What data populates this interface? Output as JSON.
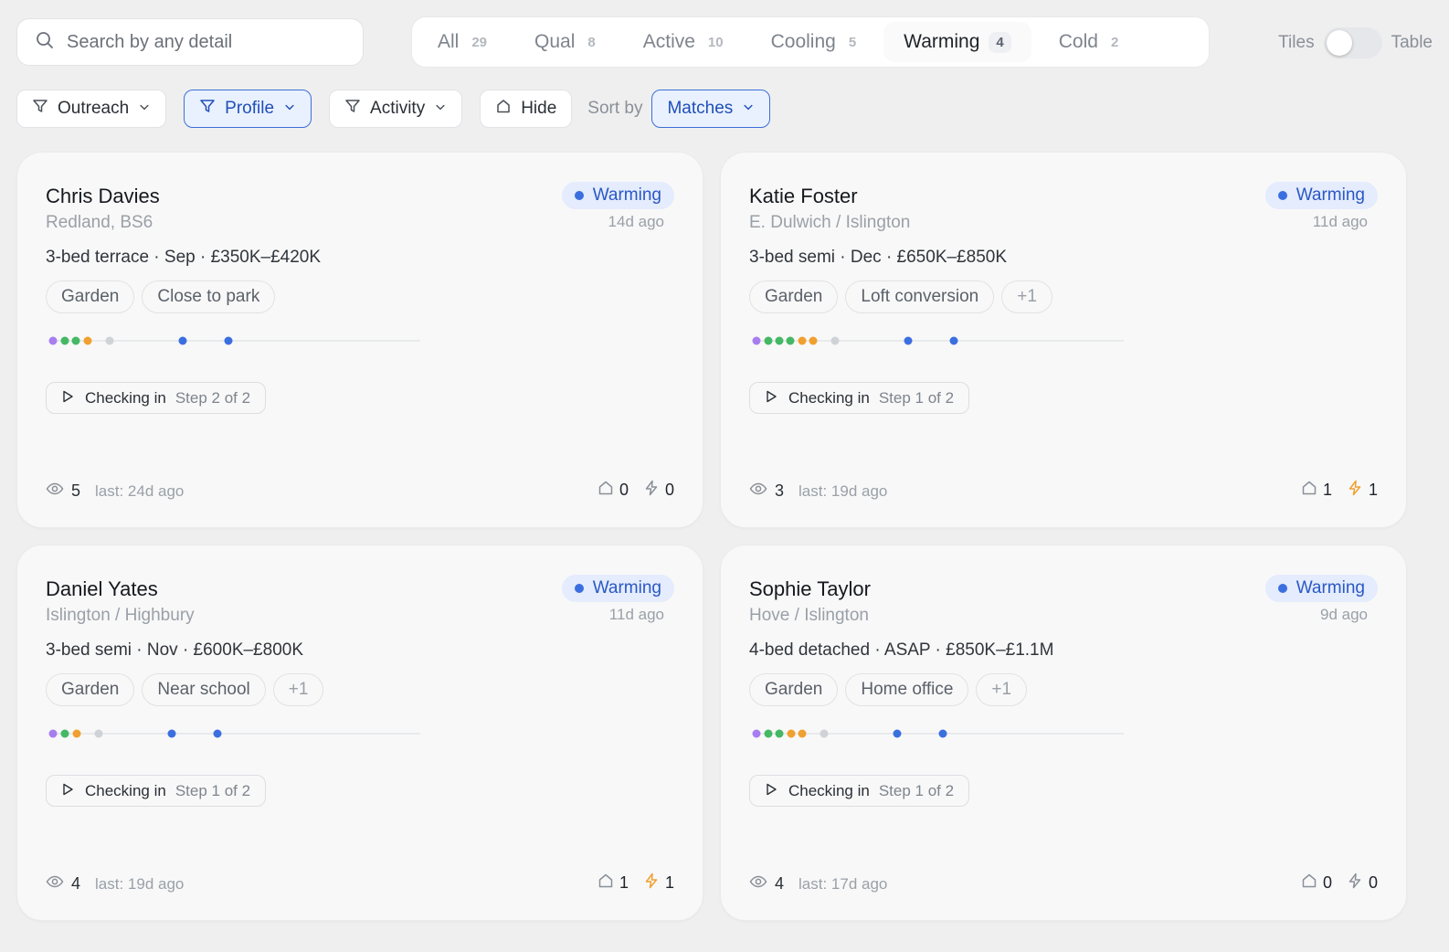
{
  "search": {
    "placeholder": "Search by any detail"
  },
  "tabs": [
    {
      "label": "All",
      "count": "29",
      "active": false
    },
    {
      "label": "Qual",
      "count": "8",
      "active": false
    },
    {
      "label": "Active",
      "count": "10",
      "active": false
    },
    {
      "label": "Cooling",
      "count": "5",
      "active": false
    },
    {
      "label": "Warming",
      "count": "4",
      "active": true
    },
    {
      "label": "Cold",
      "count": "2",
      "active": false
    }
  ],
  "view_toggle": {
    "left": "Tiles",
    "right": "Table",
    "selected": "Tiles"
  },
  "filters": {
    "outreach": "Outreach",
    "profile": "Profile",
    "activity": "Activity",
    "hide": "Hide",
    "sort_label": "Sort by",
    "sort_value": "Matches"
  },
  "colors": {
    "purple": "#a77ef0",
    "green": "#44b864",
    "orange": "#f0a030",
    "grey": "#cfd2d6",
    "blue": "#3b6fe0",
    "bolt_active": "#f0a030",
    "bolt_inactive": "#8a9099"
  },
  "cards": [
    {
      "name": "Chris Davies",
      "location": "Redland, BS6",
      "summary": "3-bed terrace · Sep · £350K–£420K",
      "status": "Warming",
      "ago": "14d ago",
      "tags": [
        "Garden",
        "Close to park"
      ],
      "timeline": [
        "purple",
        "green",
        "green",
        "orange",
        "grey",
        "blue",
        "blue"
      ],
      "step_label": "Checking in",
      "step_num": "Step 2 of 2",
      "views": "5",
      "last": "last: 24d ago",
      "homes": "0",
      "bolts": "0"
    },
    {
      "name": "Katie Foster",
      "location": "E. Dulwich / Islington",
      "summary": "3-bed semi · Dec · £650K–£850K",
      "status": "Warming",
      "ago": "11d ago",
      "tags": [
        "Garden",
        "Loft conversion",
        "+1"
      ],
      "timeline": [
        "purple",
        "green",
        "green",
        "green",
        "orange",
        "orange",
        "grey",
        "blue",
        "blue"
      ],
      "step_label": "Checking in",
      "step_num": "Step 1 of 2",
      "views": "3",
      "last": "last: 19d ago",
      "homes": "1",
      "bolts": "1"
    },
    {
      "name": "Daniel Yates",
      "location": "Islington / Highbury",
      "summary": "3-bed semi · Nov · £600K–£800K",
      "status": "Warming",
      "ago": "11d ago",
      "tags": [
        "Garden",
        "Near school",
        "+1"
      ],
      "timeline": [
        "purple",
        "green",
        "orange",
        "grey",
        "blue",
        "blue"
      ],
      "step_label": "Checking in",
      "step_num": "Step 1 of 2",
      "views": "4",
      "last": "last: 19d ago",
      "homes": "1",
      "bolts": "1"
    },
    {
      "name": "Sophie Taylor",
      "location": "Hove / Islington",
      "summary": "4-bed detached · ASAP · £850K–£1.1M",
      "status": "Warming",
      "ago": "9d ago",
      "tags": [
        "Garden",
        "Home office",
        "+1"
      ],
      "timeline": [
        "purple",
        "green",
        "green",
        "orange",
        "orange",
        "grey",
        "blue",
        "blue"
      ],
      "step_label": "Checking in",
      "step_num": "Step 1 of 2",
      "views": "4",
      "last": "last: 17d ago",
      "homes": "0",
      "bolts": "0"
    }
  ]
}
